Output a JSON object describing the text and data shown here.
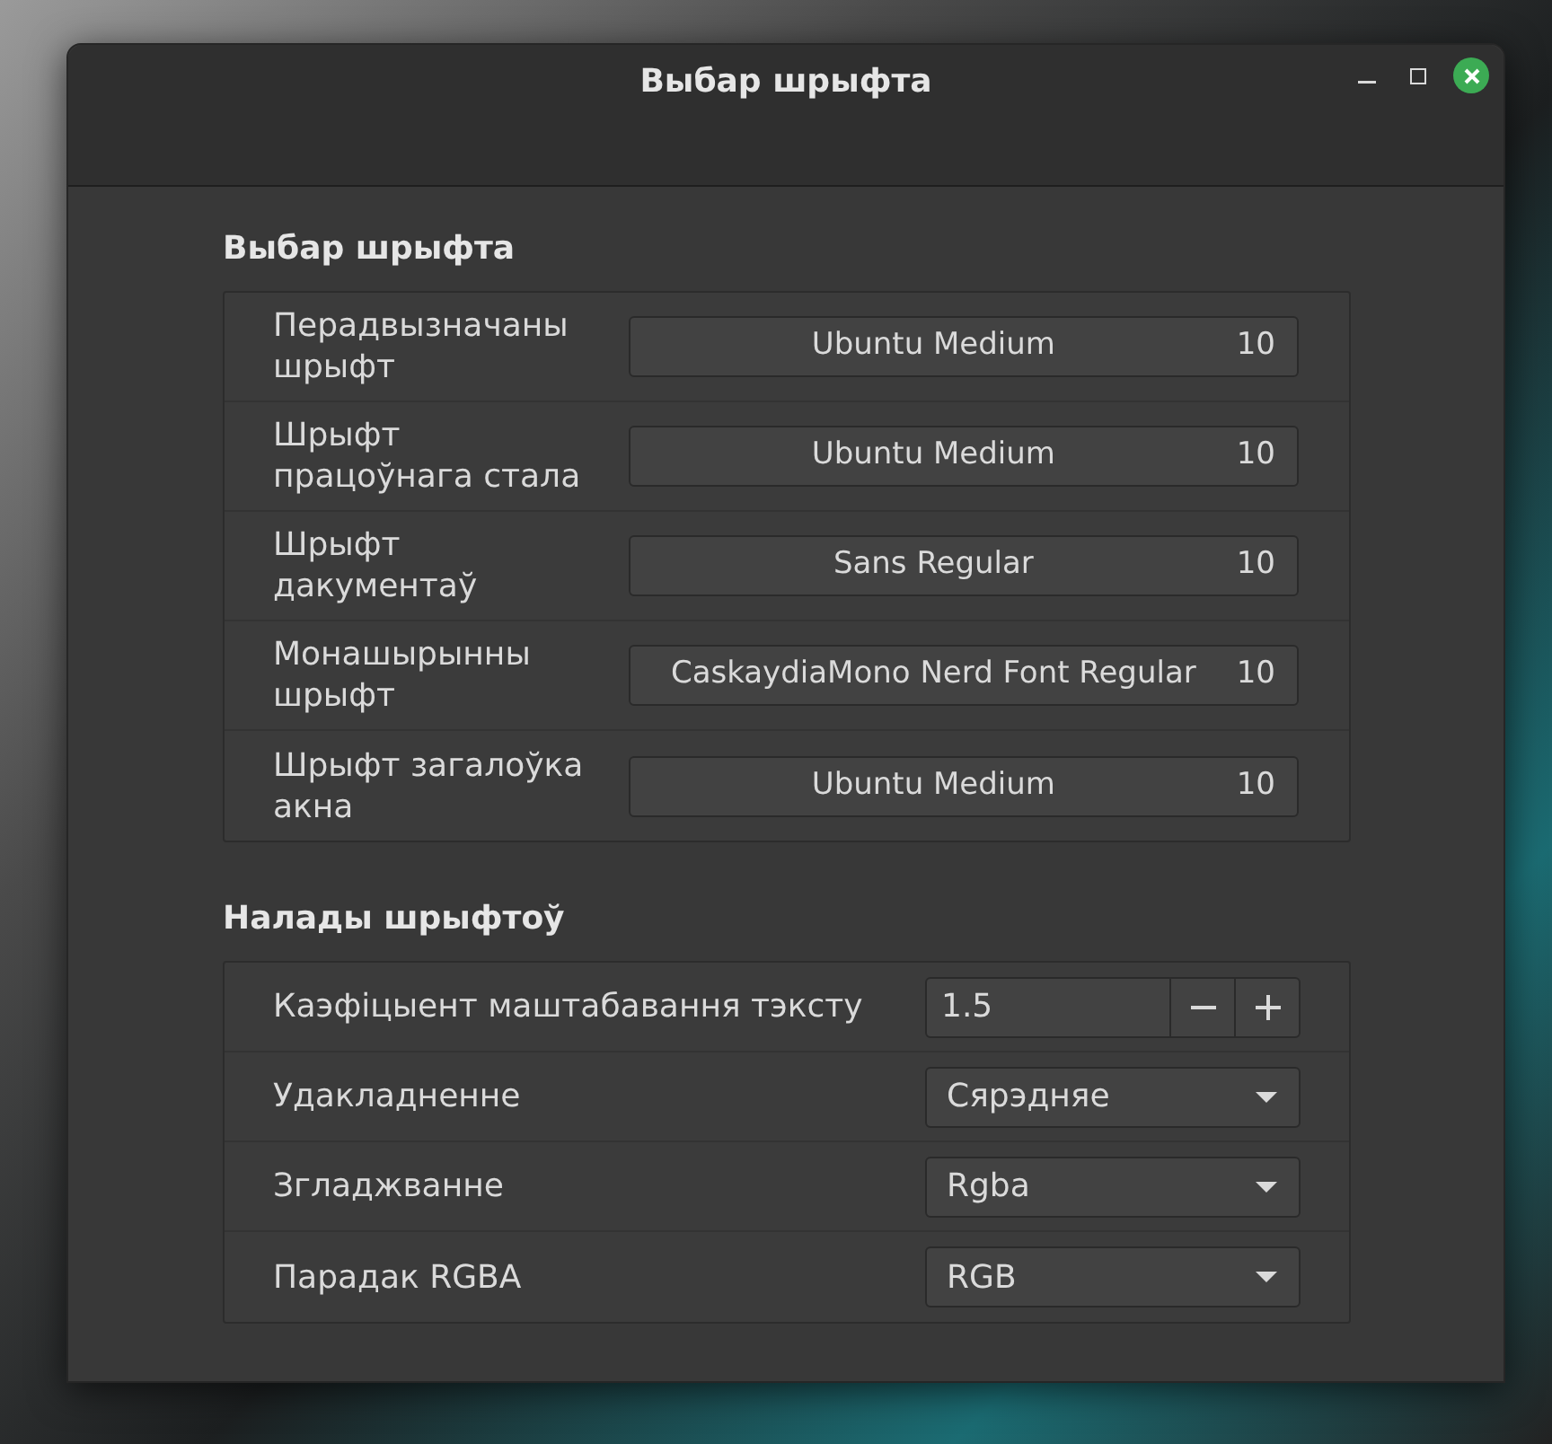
{
  "window": {
    "title": "Выбар шрыфта"
  },
  "sections": [
    {
      "title": "Выбар шрыфта",
      "rows": [
        {
          "kind": "font",
          "label": "Перадвызначаны\nшрыфт",
          "font": "Ubuntu Medium",
          "size": "10"
        },
        {
          "kind": "font",
          "label": "Шрыфт\nпрацоўнага стала",
          "font": "Ubuntu Medium",
          "size": "10"
        },
        {
          "kind": "font",
          "label": "Шрыфт\nдакументаў",
          "font": "Sans Regular",
          "size": "10"
        },
        {
          "kind": "font",
          "label": "Монашырынны\nшрыфт",
          "font": "CaskaydiaMono Nerd Font Regular",
          "size": "10"
        },
        {
          "kind": "font",
          "label": "Шрыфт загалоўка\nакна",
          "font": "Ubuntu Medium",
          "size": "10"
        }
      ]
    },
    {
      "title": "Налады шрыфтоў",
      "rows": [
        {
          "kind": "spin",
          "label": "Каэфіцыент маштабавання тэксту",
          "value": "1.5"
        },
        {
          "kind": "dropdown",
          "label": "Удакладненне",
          "value": "Сярэдняе"
        },
        {
          "kind": "dropdown",
          "label": "Згладжванне",
          "value": "Rgba"
        },
        {
          "kind": "dropdown",
          "label": "Парадак RGBA",
          "value": "RGB"
        }
      ]
    }
  ]
}
